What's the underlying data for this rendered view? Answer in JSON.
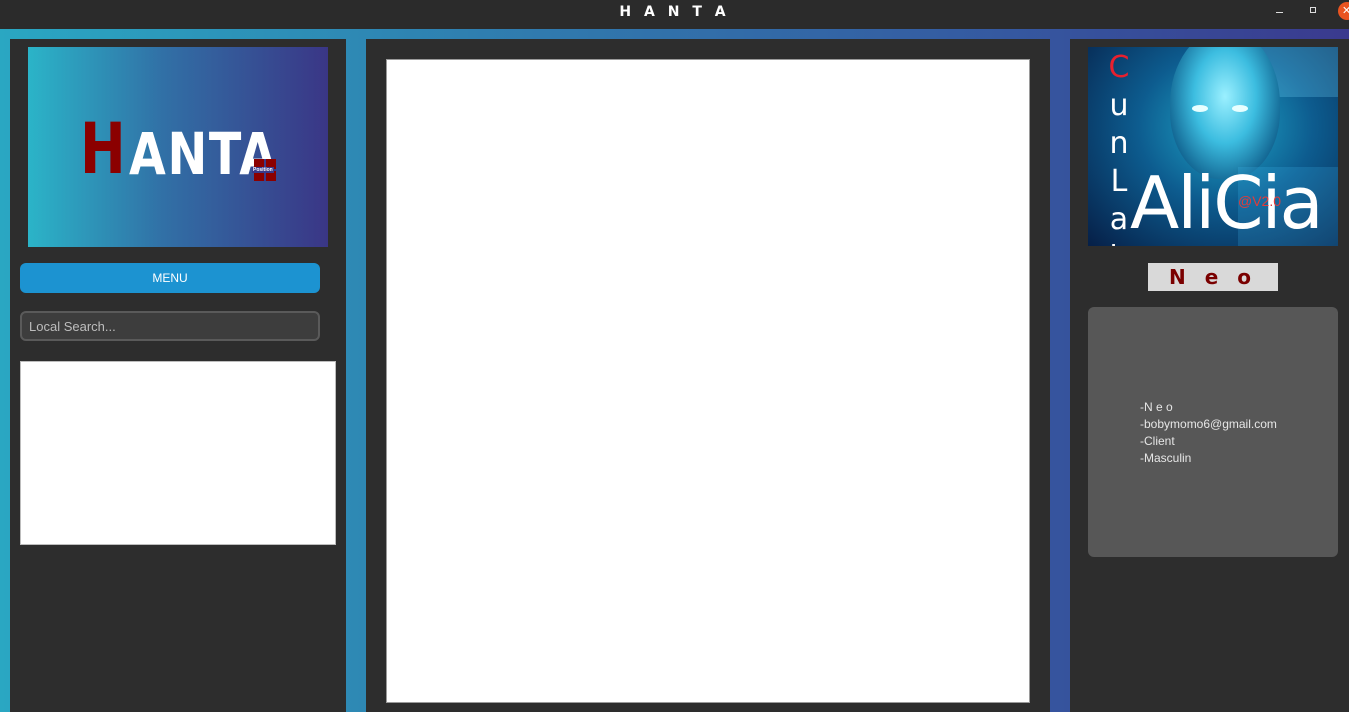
{
  "window": {
    "title": "H A N T A",
    "minimize_icon": "minimize-icon",
    "maximize_icon": "maximize-icon",
    "close_icon": "close-icon",
    "close_glyph": "✕"
  },
  "left": {
    "logo": {
      "first_letter": "H",
      "rest": "ANTA",
      "subtext": "Position"
    },
    "menu_label": "MENU",
    "search_placeholder": "Local Search..."
  },
  "right": {
    "banner": {
      "vertical_letters": [
        "C",
        "u",
        "n",
        "L",
        "a",
        "b"
      ],
      "big_text": "AliCia",
      "version": "@V2.0"
    },
    "profile_name": "N e o",
    "info": [
      "-N e o",
      "-bobymomo6@gmail.com",
      "-Client",
      "-Masculin"
    ]
  },
  "colors": {
    "accent": "#1c93d1",
    "panel": "#2d2d2d",
    "brand_red": "#8b0000",
    "card": "#575757"
  }
}
